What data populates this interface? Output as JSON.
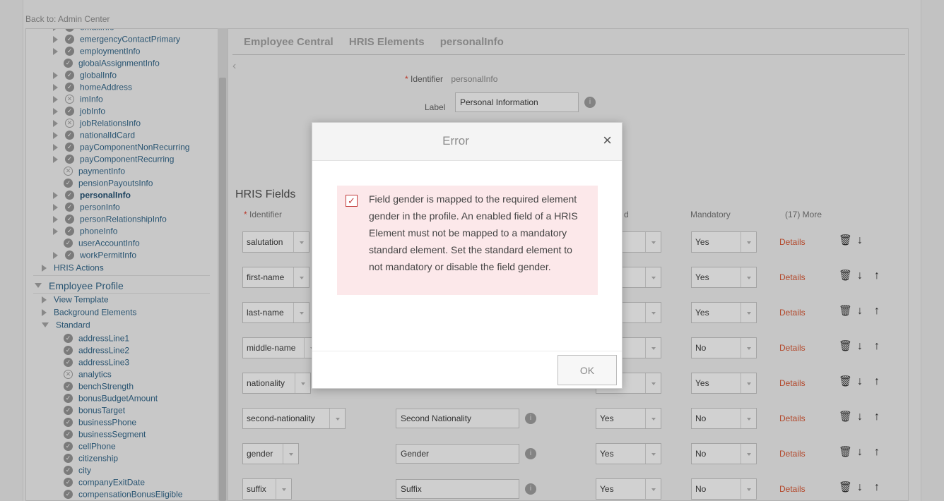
{
  "top": {
    "back_link": "Back to: Admin Center"
  },
  "tree": {
    "items": [
      {
        "label": "emailInfo",
        "icon": "check",
        "arrow": true,
        "bold": false
      },
      {
        "label": "emergencyContactPrimary",
        "icon": "check",
        "arrow": true,
        "bold": false
      },
      {
        "label": "employmentInfo",
        "icon": "check",
        "arrow": true,
        "bold": false
      },
      {
        "label": "globalAssignmentInfo",
        "icon": "check",
        "arrow": false,
        "bold": false
      },
      {
        "label": "globalInfo",
        "icon": "check",
        "arrow": true,
        "bold": false
      },
      {
        "label": "homeAddress",
        "icon": "check",
        "arrow": true,
        "bold": false
      },
      {
        "label": "imInfo",
        "icon": "x",
        "arrow": true,
        "bold": false
      },
      {
        "label": "jobInfo",
        "icon": "check",
        "arrow": true,
        "bold": false
      },
      {
        "label": "jobRelationsInfo",
        "icon": "x",
        "arrow": true,
        "bold": false
      },
      {
        "label": "nationalIdCard",
        "icon": "check",
        "arrow": true,
        "bold": false
      },
      {
        "label": "payComponentNonRecurring",
        "icon": "check",
        "arrow": true,
        "bold": false
      },
      {
        "label": "payComponentRecurring",
        "icon": "check",
        "arrow": true,
        "bold": false
      },
      {
        "label": "paymentInfo",
        "icon": "x",
        "arrow": false,
        "bold": false
      },
      {
        "label": "pensionPayoutsInfo",
        "icon": "check",
        "arrow": false,
        "bold": false
      },
      {
        "label": "personalInfo",
        "icon": "check",
        "arrow": true,
        "bold": true
      },
      {
        "label": "personInfo",
        "icon": "check",
        "arrow": true,
        "bold": false
      },
      {
        "label": "personRelationshipInfo",
        "icon": "check",
        "arrow": true,
        "bold": false
      },
      {
        "label": "phoneInfo",
        "icon": "check",
        "arrow": true,
        "bold": false
      },
      {
        "label": "userAccountInfo",
        "icon": "check",
        "arrow": false,
        "bold": false
      },
      {
        "label": "workPermitInfo",
        "icon": "check",
        "arrow": true,
        "bold": false
      }
    ],
    "hris_actions": "HRIS Actions",
    "employee_profile": "Employee Profile",
    "view_template": "View Template",
    "background_elements": "Background Elements",
    "standard": "Standard",
    "standard_items": [
      {
        "label": "addressLine1",
        "icon": "check"
      },
      {
        "label": "addressLine2",
        "icon": "check"
      },
      {
        "label": "addressLine3",
        "icon": "check"
      },
      {
        "label": "analytics",
        "icon": "x"
      },
      {
        "label": "benchStrength",
        "icon": "check"
      },
      {
        "label": "bonusBudgetAmount",
        "icon": "check"
      },
      {
        "label": "bonusTarget",
        "icon": "check"
      },
      {
        "label": "businessPhone",
        "icon": "check"
      },
      {
        "label": "businessSegment",
        "icon": "check"
      },
      {
        "label": "cellPhone",
        "icon": "check"
      },
      {
        "label": "citizenship",
        "icon": "check"
      },
      {
        "label": "city",
        "icon": "check"
      },
      {
        "label": "companyExitDate",
        "icon": "check"
      },
      {
        "label": "compensationBonusEligible",
        "icon": "check"
      }
    ]
  },
  "main": {
    "breadcrumbs": [
      "Employee Central",
      "HRIS Elements",
      "personalInfo"
    ],
    "identifier_label": "Identifier",
    "identifier_required": "*",
    "identifier_value": "personalInfo",
    "label_label": "Label",
    "label_value": "Personal Information",
    "hris_fields_title": "HRIS Fields",
    "columns": {
      "identifier": "Identifier",
      "required_mark": "*",
      "enabled_partial": "d",
      "mandatory": "Mandatory",
      "more": "(17) More"
    },
    "rows": [
      {
        "identifier": "salutation",
        "label": "",
        "enabled": "",
        "mandatory": "Yes",
        "details": "Details"
      },
      {
        "identifier": "first-name",
        "label": "",
        "enabled": "",
        "mandatory": "Yes",
        "details": "Details"
      },
      {
        "identifier": "last-name",
        "label": "",
        "enabled": "",
        "mandatory": "Yes",
        "details": "Details"
      },
      {
        "identifier": "middle-name",
        "label": "",
        "enabled": "",
        "mandatory": "No",
        "details": "Details"
      },
      {
        "identifier": "nationality",
        "label": "",
        "enabled": "",
        "mandatory": "Yes",
        "details": "Details"
      },
      {
        "identifier": "second-nationality",
        "label": "Second Nationality",
        "enabled": "Yes",
        "mandatory": "No",
        "details": "Details"
      },
      {
        "identifier": "gender",
        "label": "Gender",
        "enabled": "Yes",
        "mandatory": "No",
        "details": "Details"
      },
      {
        "identifier": "suffix",
        "label": "Suffix",
        "enabled": "Yes",
        "mandatory": "No",
        "details": "Details"
      }
    ]
  },
  "modal": {
    "title": "Error",
    "close": "×",
    "message": "Field gender is mapped to the required element gender in the profile. An enabled field of a HRIS Element must not be mapped to a mandatory standard element. Set the standard element to not mandatory or disable the field gender.",
    "ok_label": "OK"
  },
  "icons": {
    "check": "✓",
    "x": "✕",
    "info": "i",
    "trash": "🗑",
    "down": "↓",
    "up": "↑",
    "chevron_left": "‹"
  },
  "colors": {
    "link": "#2c5876",
    "details": "#b94a2c",
    "error_bg": "#fce8ea",
    "required": "#c0392b"
  }
}
